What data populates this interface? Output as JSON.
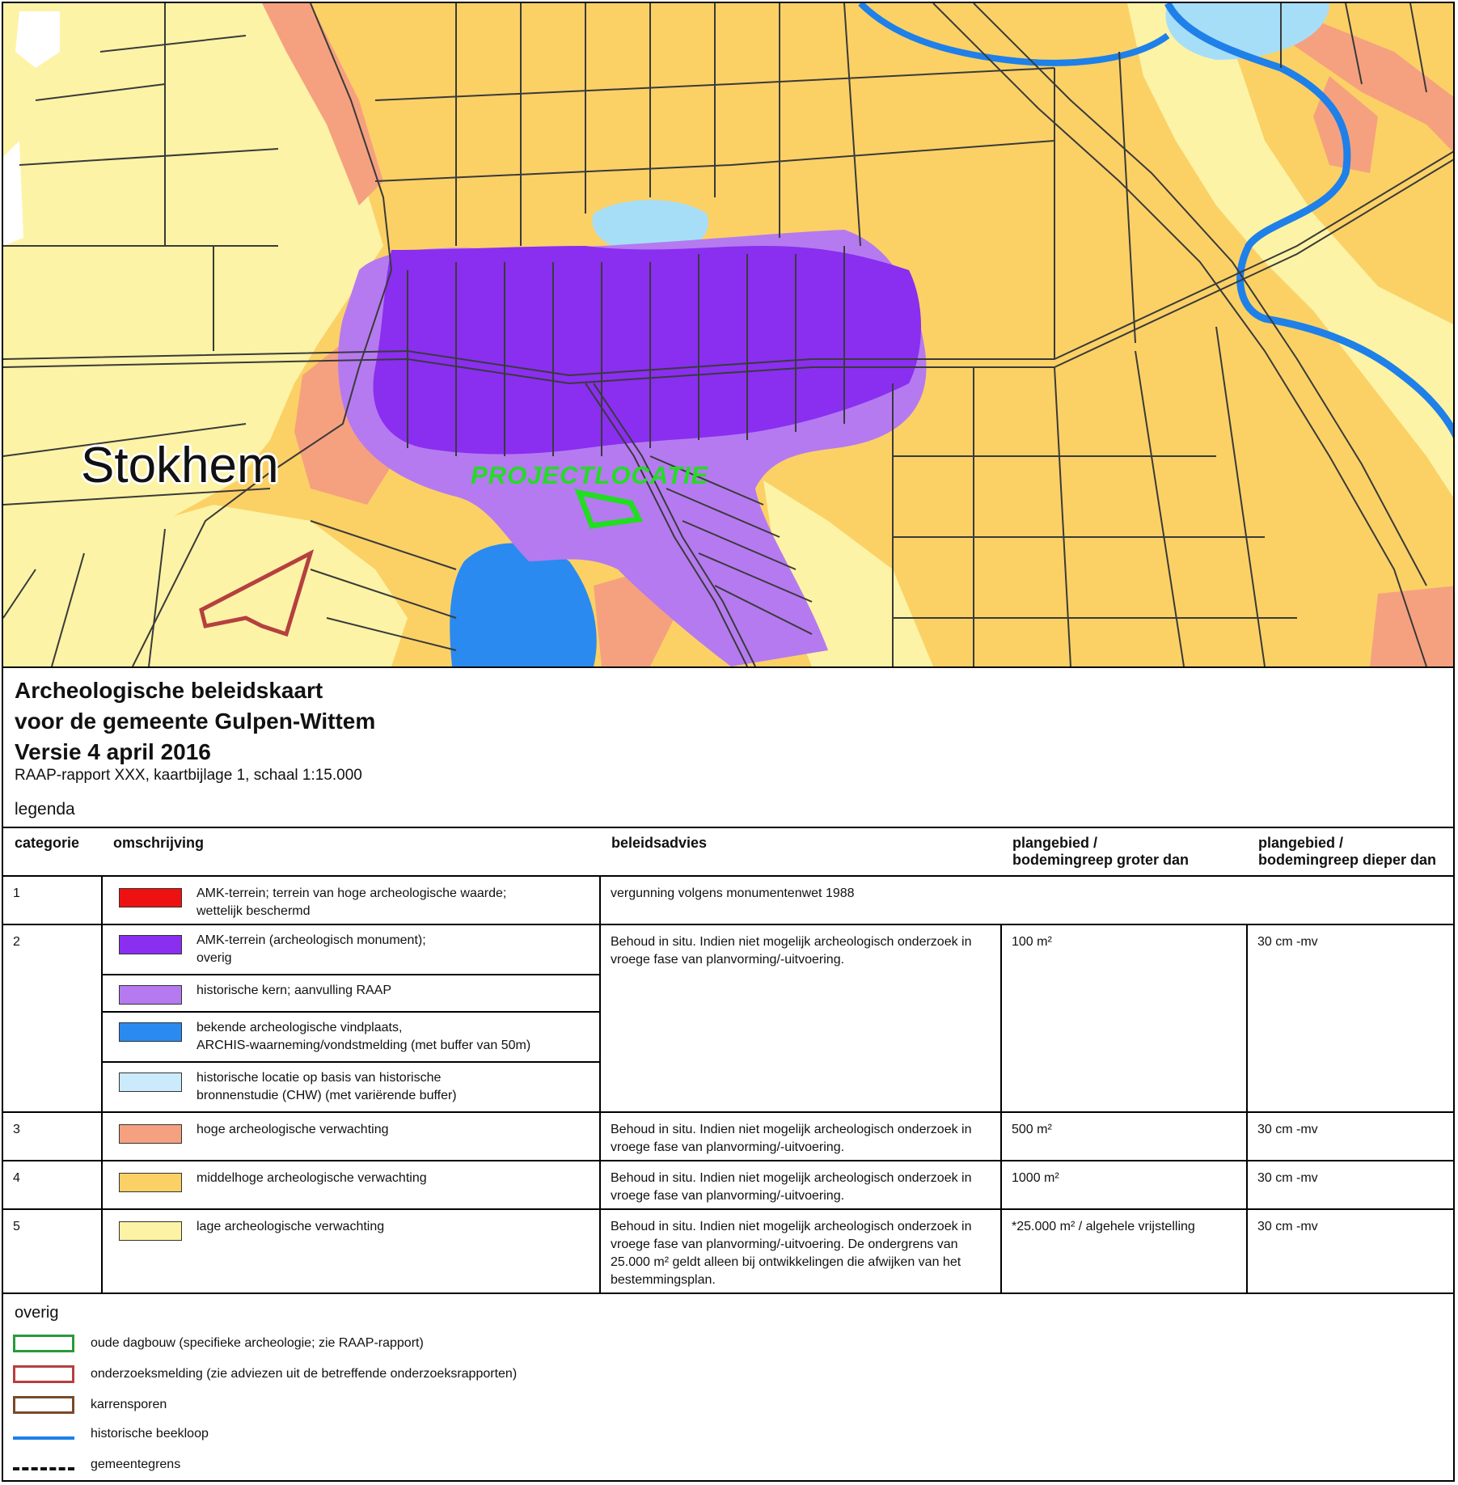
{
  "map": {
    "place_label": "Stokhem",
    "project_label": "PROJECTLOCATIE",
    "colors": {
      "low": "#fcf3a6",
      "mid": "#fbd166",
      "high": "#f5a17f",
      "monument": "#8a2ef0",
      "core": "#b57af0",
      "findspot": "#2a8af0",
      "historic": "#a6def8",
      "stream": "#1e80e8",
      "project": "#22dd22",
      "research": "#b5403f"
    }
  },
  "legend": {
    "title1": "Archeologische beleidskaart",
    "title2": "voor de gemeente Gulpen-Wittem",
    "title3": "Versie 4 april 2016",
    "subtitle": "RAAP-rapport XXX, kaartbijlage 1, schaal 1:15.000",
    "legend_label": "legenda",
    "headers": {
      "categorie": "categorie",
      "omschrijving": "omschrijving",
      "beleidsadvies": "beleidsadvies",
      "plangebied1_line1": "plangebied /",
      "plangebied1_line2": "bodemingreep groter dan",
      "plangebied2_line1": "plangebied /",
      "plangebied2_line2": "bodemingreep dieper dan"
    },
    "rows": [
      {
        "cat": "1",
        "items": [
          {
            "color": "#ee1111",
            "text1": "AMK-terrein; terrein van hoge archeologische waarde;",
            "text2": "wettelijk beschermd"
          }
        ],
        "advice": "vergunning volgens monumentenwet 1988",
        "area": "",
        "depth": ""
      },
      {
        "cat": "2",
        "items": [
          {
            "color": "#8a2ef0",
            "text1": "AMK-terrein (archeologisch monument);",
            "text2": "overig"
          },
          {
            "color": "#b57af0",
            "text1": "historische kern; aanvulling RAAP",
            "text2": ""
          },
          {
            "color": "#2a8af0",
            "text1": "bekende archeologische vindplaats,",
            "text2": "ARCHIS-waarneming/vondstmelding (met buffer van 50m)"
          },
          {
            "color": "#cbeafb",
            "text1": "historische locatie op basis van historische",
            "text2": "bronnenstudie (CHW) (met variërende buffer)"
          }
        ],
        "advice": "Behoud in situ. Indien niet mogelijk archeologisch onderzoek in vroege fase van planvorming/-uitvoering.",
        "area": "100 m²",
        "depth": "30 cm -mv"
      },
      {
        "cat": "3",
        "items": [
          {
            "color": "#f5a17f",
            "text1": "hoge archeologische verwachting",
            "text2": ""
          }
        ],
        "advice": "Behoud in situ. Indien niet mogelijk archeologisch onderzoek in vroege fase van planvorming/-uitvoering.",
        "area": "500 m²",
        "depth": "30 cm -mv"
      },
      {
        "cat": "4",
        "items": [
          {
            "color": "#fbd166",
            "text1": "middelhoge archeologische verwachting",
            "text2": ""
          }
        ],
        "advice": "Behoud in situ. Indien niet mogelijk archeologisch onderzoek in vroege fase van planvorming/-uitvoering.",
        "area": "1000 m²",
        "depth": "30 cm -mv"
      },
      {
        "cat": "5",
        "items": [
          {
            "color": "#fcf3a6",
            "text1": "lage archeologische verwachting",
            "text2": ""
          }
        ],
        "advice": "Behoud in situ. Indien niet mogelijk archeologisch onderzoek in vroege fase van planvorming/-uitvoering. De ondergrens van 25.000 m² geldt alleen bij ontwikkelingen die afwijken van het bestemmingsplan.",
        "area": "*25.000 m² / algehele vrijstelling",
        "depth": "30 cm -mv"
      }
    ],
    "overig": {
      "title": "overig",
      "items": [
        {
          "style": "box",
          "color": "#2a9a3a",
          "text": "oude dagbouw (specifieke archeologie; zie RAAP-rapport)"
        },
        {
          "style": "box",
          "color": "#b5403f",
          "text": "onderzoeksmelding (zie adviezen uit de betreffende onderzoeksrapporten)"
        },
        {
          "style": "box",
          "color": "#7a4a2a",
          "text": "karrensporen"
        },
        {
          "style": "line",
          "color": "#1e80e8",
          "text": "historische beekloop"
        },
        {
          "style": "dash",
          "color": "#111111",
          "text": "gemeentegrens"
        }
      ]
    }
  }
}
